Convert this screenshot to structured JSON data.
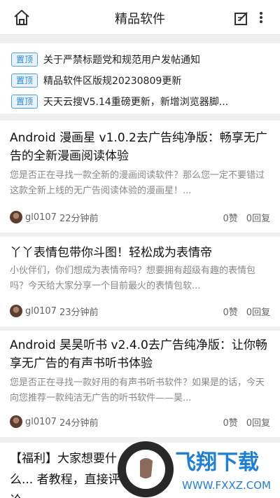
{
  "header": {
    "title": "精品软件"
  },
  "pinned": [
    {
      "badge": "置顶",
      "text": "关于严禁标题党和规范用户发帖通知"
    },
    {
      "badge": "置顶",
      "text": "精品软件区版规20230809更新"
    },
    {
      "badge": "置顶",
      "text": "天天云搜V5.14重磅更新，新增浏览器脚..."
    }
  ],
  "posts": [
    {
      "title": "Android 漫画星 v1.0.2去广告纯净版：畅享无广告的全新漫画阅读体验",
      "summary": "您是否正在寻找一款全新的漫画阅读软件？那么您一定不要错过这款全新上线的无广告阅读体验的漫画星！...",
      "author": "gl0107",
      "time": "22分钟前",
      "likes": "0赞",
      "replies": "0回复"
    },
    {
      "title": "丫丫表情包带你斗图！轻松成为表情帝",
      "summary": "小伙伴们，你们想成为表情帝吗？想要拥有超级有趣的表情包吗？今天给大家分享一个目前最火的表情包软...",
      "author": "gl0107",
      "time": "23分钟前",
      "likes": "0赞",
      "replies": "0回复"
    },
    {
      "title": "Android 昊昊听书 v2.4.0去广告纯净版：让你畅享无广告的有声书听书体验",
      "summary": "您是否正在寻找一款好用的有声书听书软件？如果是的话，今天向您推荐一款纯洁无广告的听书软件——昊...",
      "author": "gl0107",
      "time": "24分钟前",
      "likes": "0赞",
      "replies": "0回复"
    },
    {
      "title": "【福利】大家想要什么... 者教程，直接评论，...",
      "summary": "",
      "author": "",
      "time": "",
      "likes": "",
      "replies": ""
    }
  ],
  "watermark": {
    "text": "飞翔下载",
    "url": "WWW.FXXZ.COM"
  },
  "colors": {
    "badge": "#2c86d8",
    "badge_bg": "#e8f3fd",
    "background": "#f0f0f0"
  }
}
